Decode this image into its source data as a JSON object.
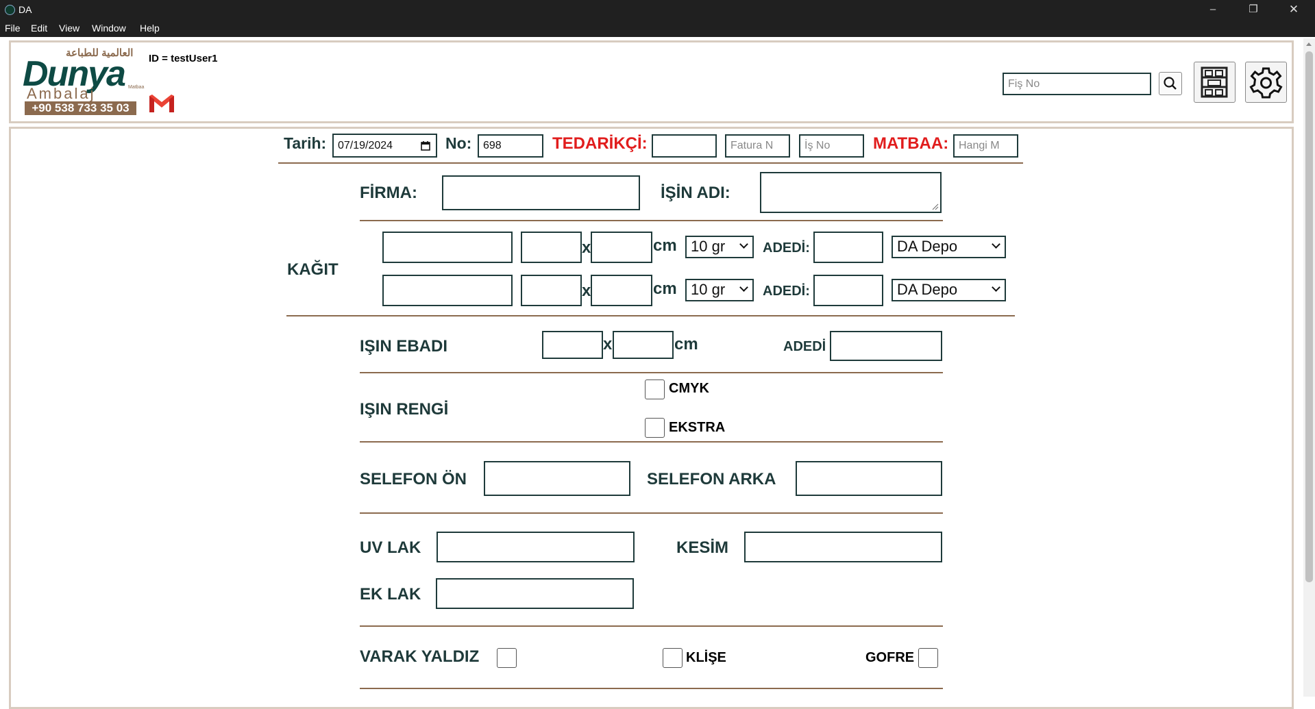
{
  "window": {
    "title": "DA"
  },
  "menu": [
    "File",
    "Edit",
    "View",
    "Window",
    "Help"
  ],
  "header": {
    "logo_arabic": "العالمية للطباعة",
    "logo_brand": "Dunya",
    "logo_sub": "Ambalaj",
    "logo_small": "Matbaa",
    "phone": "+90 538 733 35 03",
    "user_id": "ID = testUser1",
    "search_placeholder": "Fiş No"
  },
  "form": {
    "tarih_label": "Tarih:",
    "tarih_value": "07/19/2024",
    "no_label": "No:",
    "no_value": "698",
    "tedarikci_label": "TEDARİKÇİ:",
    "fatura_placeholder": "Fatura N",
    "isno_placeholder": "İş No",
    "matbaa_label": "MATBAA:",
    "matbaa_placeholder": "Hangi M",
    "firma_label": "FİRMA:",
    "isin_adi_label": "İŞİN ADI:",
    "kagit_label": "KAĞIT",
    "x": "x",
    "cm": "cm",
    "gram_value": "10 gr",
    "adedi_label": "ADEDİ:",
    "depo_value": "DA Depo",
    "isin_ebadi_label": "IŞIN EBADI",
    "adedi2_label": "ADEDİ",
    "isin_rengi_label": "IŞIN RENGİ",
    "cmyk_label": "CMYK",
    "ekstra_label": "EKSTRA",
    "selefon_on_label": "SELEFON ÖN",
    "selefon_arka_label": "SELEFON ARKA",
    "uv_lak_label": "UV LAK",
    "kesim_label": "KESİM",
    "ek_lak_label": "EK LAK",
    "varak_label": "VARAK YALDIZ",
    "klise_label": "KLİŞE",
    "gofre_label": "GOFRE"
  }
}
